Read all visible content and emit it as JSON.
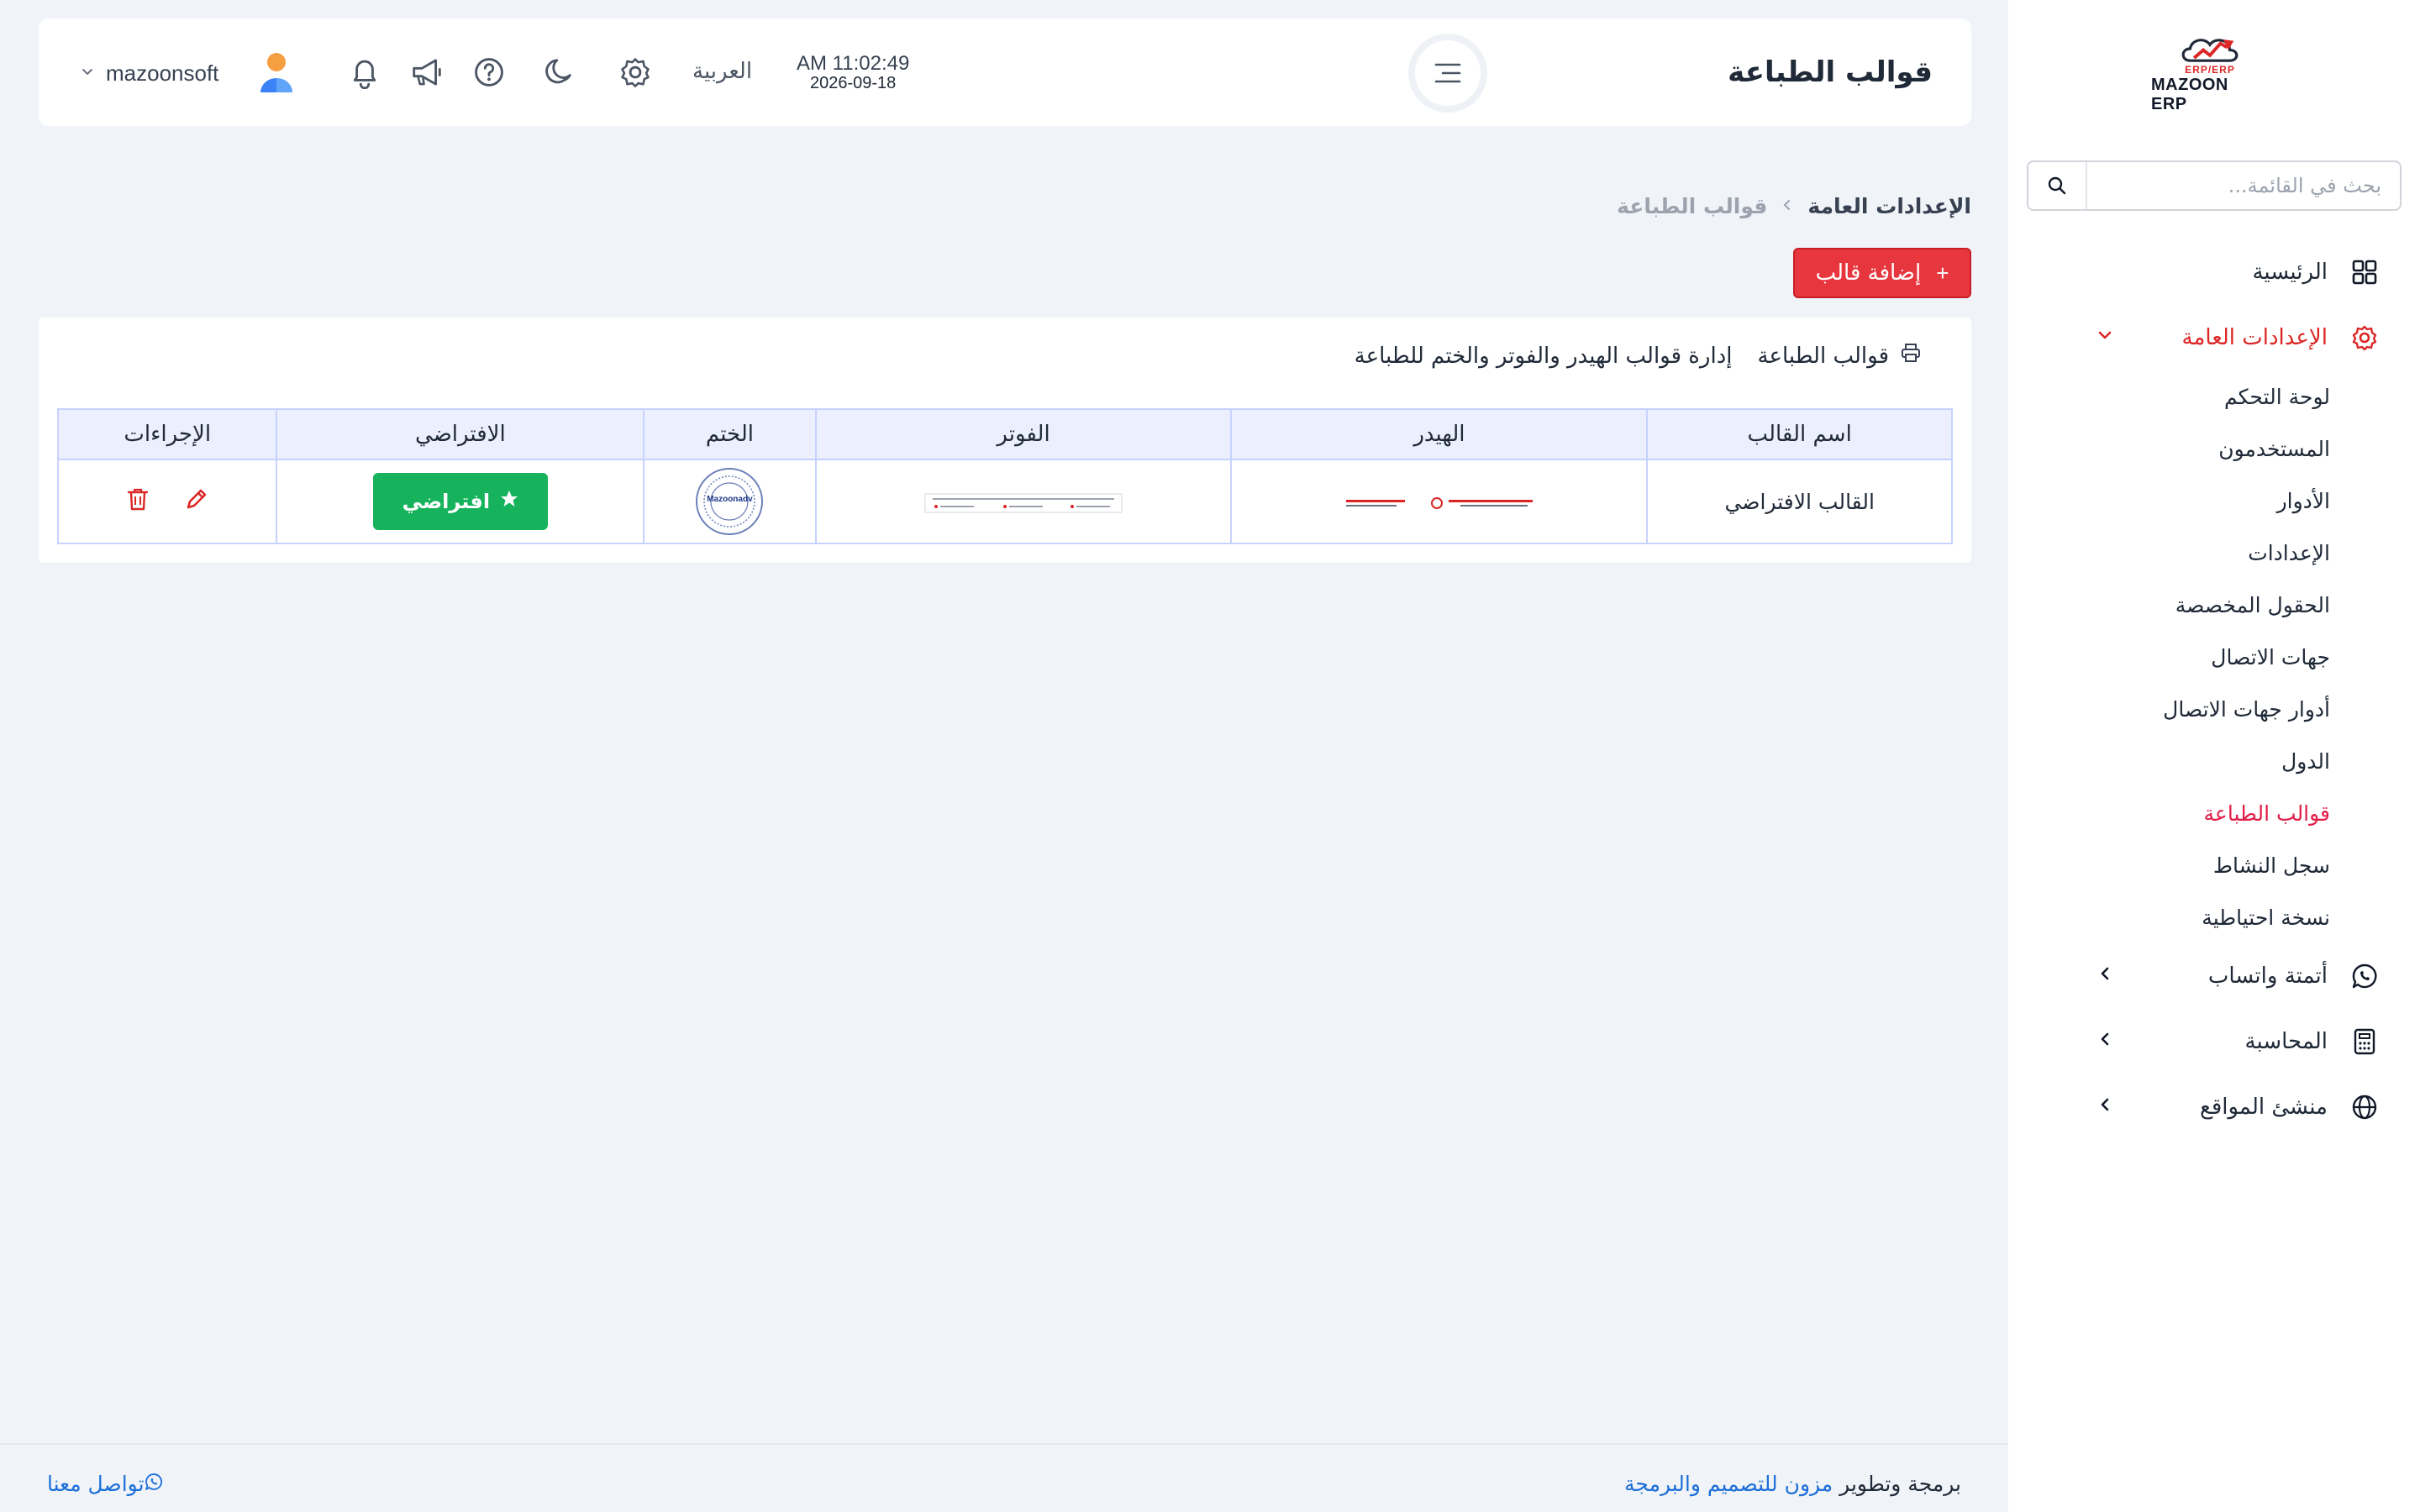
{
  "brand": {
    "name": "MAZOON ERP",
    "sub": "ERP/ERP"
  },
  "sidebar": {
    "search_placeholder": "بحث في القائمة...",
    "items": [
      {
        "label": "الرئيسية",
        "icon": "grid-icon"
      },
      {
        "label": "الإعدادات العامة",
        "icon": "gear-icon",
        "expanded": true
      },
      {
        "label": "أتمتة واتساب",
        "icon": "whatsapp-icon"
      },
      {
        "label": "المحاسبة",
        "icon": "calculator-icon"
      },
      {
        "label": "منشئ المواقع",
        "icon": "globe-icon"
      }
    ],
    "sub_items": [
      "لوحة التحكم",
      "المستخدمون",
      "الأدوار",
      "الإعدادات",
      "الحقول المخصصة",
      "جهات الاتصال",
      "أدوار جهات الاتصال",
      "الدول",
      "قوالب الطباعة",
      "سجل النشاط",
      "نسخة احتياطية"
    ]
  },
  "header": {
    "title": "قوالب الطباعة",
    "time": "AM 11:02:49",
    "date": "2026-09-18",
    "language": "العربية",
    "user": "mazoonsoft"
  },
  "breadcrumb": {
    "root": "الإعدادات العامة",
    "current": "قوالب الطباعة"
  },
  "actions": {
    "add_template": "إضافة قالب"
  },
  "card": {
    "title": "قوالب الطباعة",
    "description": "إدارة قوالب الهيدر والفوتر والختم للطباعة"
  },
  "table": {
    "columns": [
      "اسم القالب",
      "الهيدر",
      "الفوتر",
      "الختم",
      "الافتراضي",
      "الإجراءات"
    ],
    "rows": [
      {
        "name": "القالب الافتراضي",
        "default_label": "افتراضي",
        "seal_text": "Mazoonadv"
      }
    ]
  },
  "footer": {
    "credit_prefix": "برمجة وتطوير",
    "credit_link": "مزون للتصميم والبرمجة",
    "contact": "تواصل معنا"
  },
  "colors": {
    "accent_red": "#e8363f",
    "active_pink": "#e11d48",
    "success_green": "#16b35c",
    "link_blue": "#1d6fd8"
  }
}
